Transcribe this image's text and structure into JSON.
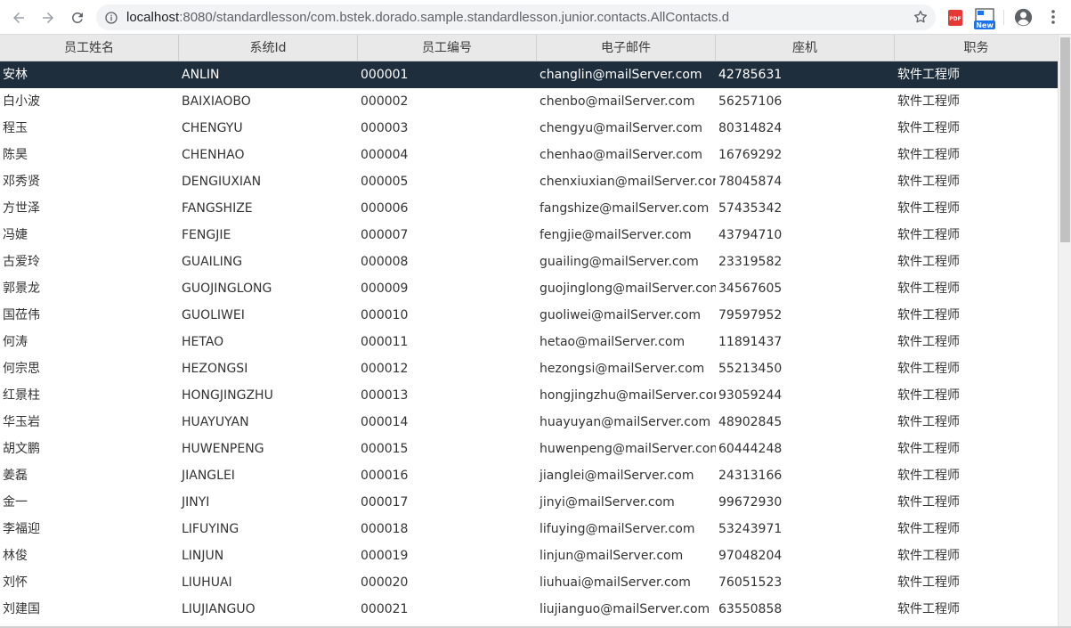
{
  "browser": {
    "url_host": "localhost",
    "url_rest": ":8080/standardlesson/com.bstek.dorado.sample.standardlesson.junior.contacts.AllContacts.d",
    "ext_pdf_label": "PDF",
    "ext_new_label": "New"
  },
  "grid": {
    "columns": [
      "员工姓名",
      "系统Id",
      "员工编号",
      "电子邮件",
      "座机",
      "职务"
    ],
    "selected_index": 0,
    "rows": [
      [
        "安林",
        "ANLIN",
        "000001",
        "changlin@mailServer.com",
        "42785631",
        "软件工程师"
      ],
      [
        "白小波",
        "BAIXIAOBO",
        "000002",
        "chenbo@mailServer.com",
        "56257106",
        "软件工程师"
      ],
      [
        "程玉",
        "CHENGYU",
        "000003",
        "chengyu@mailServer.com",
        "80314824",
        "软件工程师"
      ],
      [
        "陈昊",
        "CHENHAO",
        "000004",
        "chenhao@mailServer.com",
        "16769292",
        "软件工程师"
      ],
      [
        "邓秀贤",
        "DENGIUXIAN",
        "000005",
        "chenxiuxian@mailServer.com",
        "78045874",
        "软件工程师"
      ],
      [
        "方世泽",
        "FANGSHIZE",
        "000006",
        "fangshize@mailServer.com",
        "57435342",
        "软件工程师"
      ],
      [
        "冯婕",
        "FENGJIE",
        "000007",
        "fengjie@mailServer.com",
        "43794710",
        "软件工程师"
      ],
      [
        "古爱玲",
        "GUAILING",
        "000008",
        "guailing@mailServer.com",
        "23319582",
        "软件工程师"
      ],
      [
        "郭景龙",
        "GUOJINGLONG",
        "000009",
        "guojinglong@mailServer.com",
        "34567605",
        "软件工程师"
      ],
      [
        "国莅伟",
        "GUOLIWEI",
        "000010",
        "guoliwei@mailServer.com",
        "79597952",
        "软件工程师"
      ],
      [
        "何涛",
        "HETAO",
        "000011",
        "hetao@mailServer.com",
        "11891437",
        "软件工程师"
      ],
      [
        "何宗思",
        "HEZONGSI",
        "000012",
        "hezongsi@mailServer.com",
        "55213450",
        "软件工程师"
      ],
      [
        "红景柱",
        "HONGJINGZHU",
        "000013",
        "hongjingzhu@mailServer.com",
        "93059244",
        "软件工程师"
      ],
      [
        "华玉岩",
        "HUAYUYAN",
        "000014",
        "huayuyan@mailServer.com",
        "48902845",
        "软件工程师"
      ],
      [
        "胡文鹏",
        "HUWENPENG",
        "000015",
        "huwenpeng@mailServer.com",
        "60444248",
        "软件工程师"
      ],
      [
        "姜磊",
        "JIANGLEI",
        "000016",
        "jianglei@mailServer.com",
        "24313166",
        "软件工程师"
      ],
      [
        "金一",
        "JINYI",
        "000017",
        "jinyi@mailServer.com",
        "99672930",
        "软件工程师"
      ],
      [
        "李福迎",
        "LIFUYING",
        "000018",
        "lifuying@mailServer.com",
        "53243971",
        "软件工程师"
      ],
      [
        "林俊",
        "LINJUN",
        "000019",
        "linjun@mailServer.com",
        "97048204",
        "软件工程师"
      ],
      [
        "刘怀",
        "LIUHUAI",
        "000020",
        "liuhuai@mailServer.com",
        "76051523",
        "软件工程师"
      ],
      [
        "刘建国",
        "LIUJIANGUO",
        "000021",
        "liujianguo@mailServer.com",
        "63550858",
        "软件工程师"
      ]
    ]
  }
}
